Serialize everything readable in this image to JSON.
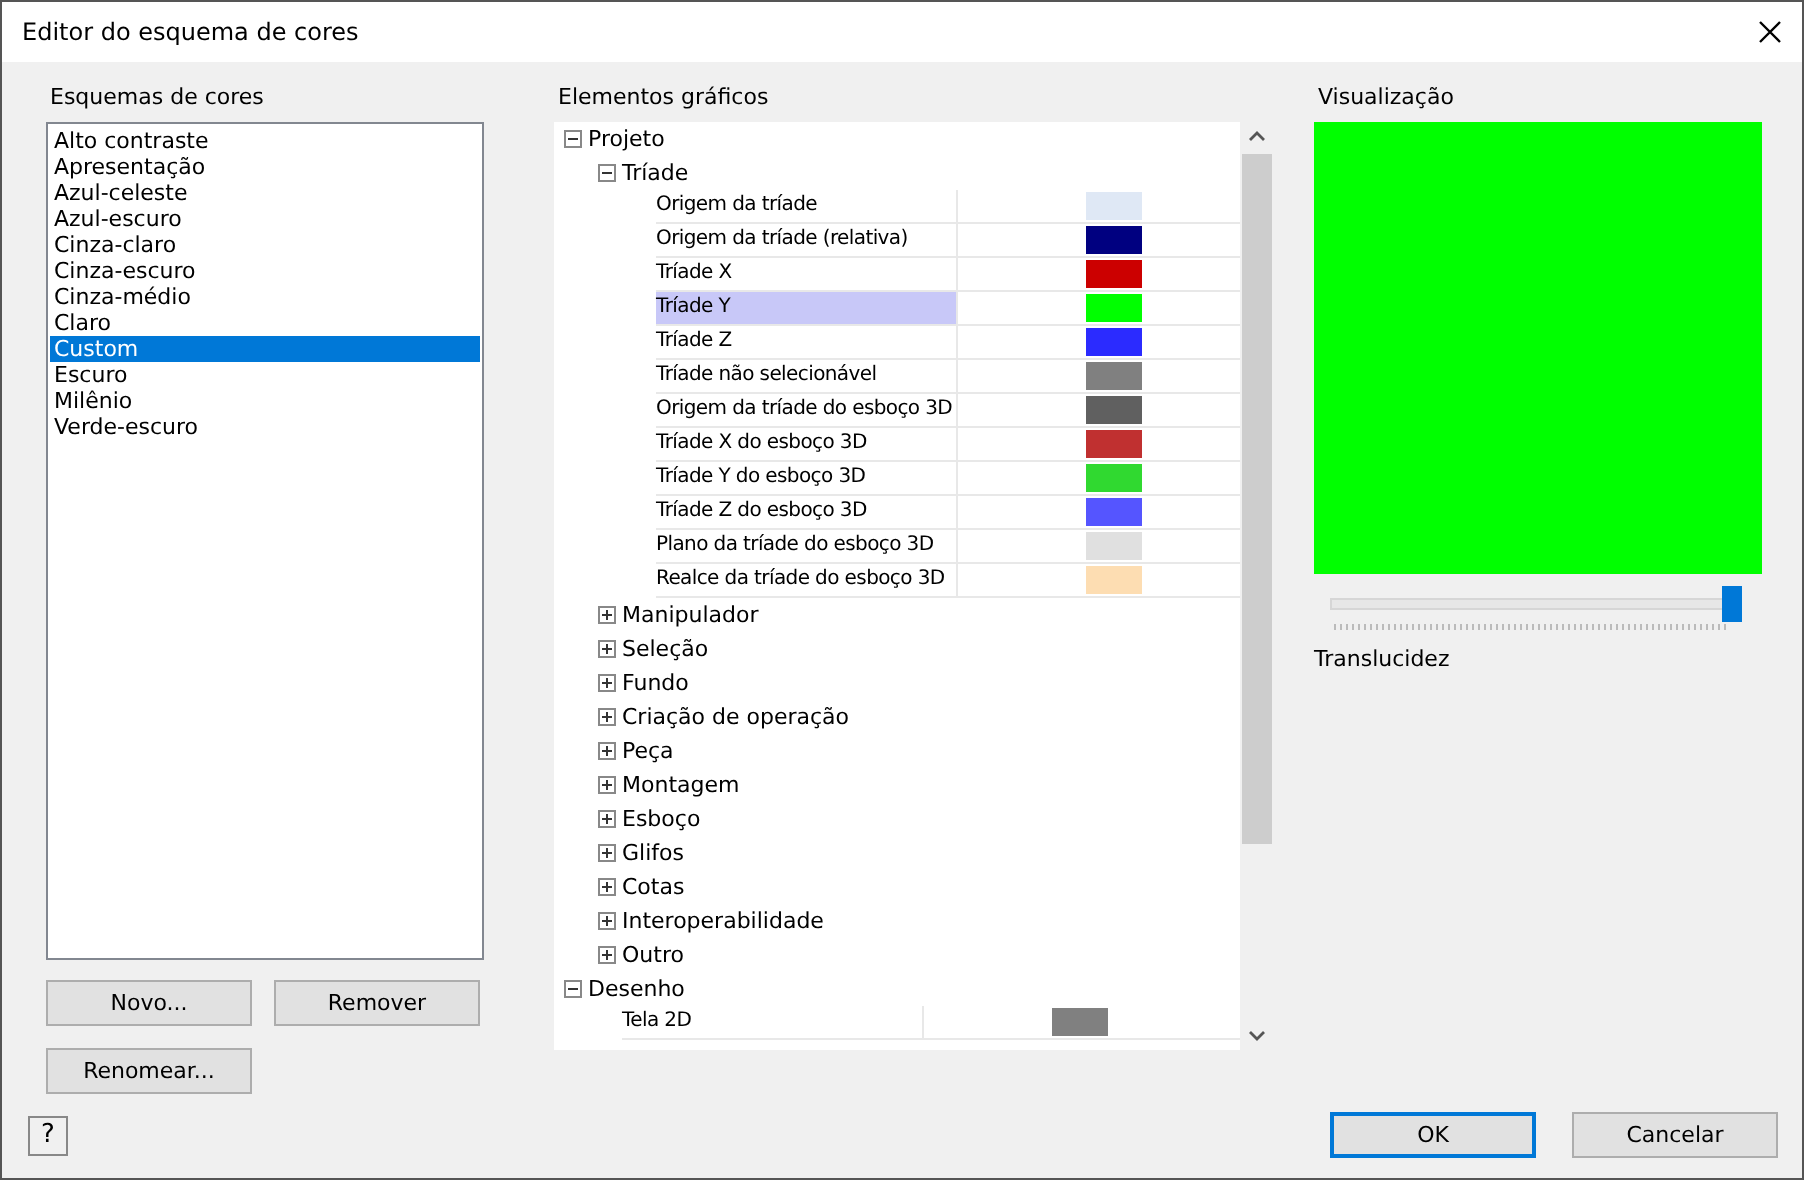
{
  "window": {
    "title": "Editor do esquema de cores"
  },
  "schemes": {
    "label": "Esquemas de cores",
    "items": [
      {
        "label": "Alto contraste",
        "selected": false
      },
      {
        "label": "Apresentação",
        "selected": false
      },
      {
        "label": "Azul-celeste",
        "selected": false
      },
      {
        "label": "Azul-escuro",
        "selected": false
      },
      {
        "label": "Cinza-claro",
        "selected": false
      },
      {
        "label": "Cinza-escuro",
        "selected": false
      },
      {
        "label": "Cinza-médio",
        "selected": false
      },
      {
        "label": "Claro",
        "selected": false
      },
      {
        "label": "Custom",
        "selected": true
      },
      {
        "label": "Escuro",
        "selected": false
      },
      {
        "label": "Milênio",
        "selected": false
      },
      {
        "label": "Verde-escuro",
        "selected": false
      }
    ],
    "buttons": [
      "Novo...",
      "Remover",
      "Renomear..."
    ]
  },
  "elements": {
    "label": "Elementos gráficos",
    "tree": [
      {
        "kind": "group",
        "label": "Projeto",
        "expanded": true,
        "children": [
          {
            "kind": "group",
            "label": "Tríade",
            "expanded": true,
            "children": [
              {
                "kind": "color",
                "label": "Origem da tríade",
                "color": "#dfe8f5",
                "selected": false
              },
              {
                "kind": "color",
                "label": "Origem da tríade (relativa)",
                "color": "#000080",
                "selected": false
              },
              {
                "kind": "color",
                "label": "Tríade X",
                "color": "#cc0000",
                "selected": false
              },
              {
                "kind": "color",
                "label": "Tríade Y",
                "color": "#00ff00",
                "selected": true
              },
              {
                "kind": "color",
                "label": "Tríade Z",
                "color": "#2b2bff",
                "selected": false
              },
              {
                "kind": "color",
                "label": "Tríade não selecionável",
                "color": "#808080",
                "selected": false
              },
              {
                "kind": "color",
                "label": "Origem da tríade do esboço 3D",
                "color": "#606060",
                "selected": false
              },
              {
                "kind": "color",
                "label": "Tríade X do esboço 3D",
                "color": "#c03030",
                "selected": false
              },
              {
                "kind": "color",
                "label": "Tríade Y do esboço 3D",
                "color": "#30d930",
                "selected": false
              },
              {
                "kind": "color",
                "label": "Tríade Z do esboço 3D",
                "color": "#5555ff",
                "selected": false
              },
              {
                "kind": "color",
                "label": "Plano da tríade do esboço 3D",
                "color": "#e0e0e0",
                "selected": false
              },
              {
                "kind": "color",
                "label": "Realce da tríade do esboço 3D",
                "color": "#fdddb2",
                "selected": false
              }
            ]
          },
          {
            "kind": "group",
            "label": "Manipulador",
            "expanded": false
          },
          {
            "kind": "group",
            "label": "Seleção",
            "expanded": false
          },
          {
            "kind": "group",
            "label": "Fundo",
            "expanded": false
          },
          {
            "kind": "group",
            "label": "Criação de operação",
            "expanded": false
          },
          {
            "kind": "group",
            "label": "Peça",
            "expanded": false
          },
          {
            "kind": "group",
            "label": "Montagem",
            "expanded": false
          },
          {
            "kind": "group",
            "label": "Esboço",
            "expanded": false
          },
          {
            "kind": "group",
            "label": "Glifos",
            "expanded": false
          },
          {
            "kind": "group",
            "label": "Cotas",
            "expanded": false
          },
          {
            "kind": "group",
            "label": "Interoperabilidade",
            "expanded": false
          },
          {
            "kind": "group",
            "label": "Outro",
            "expanded": false
          }
        ]
      },
      {
        "kind": "group",
        "label": "Desenho",
        "expanded": true,
        "children": [
          {
            "kind": "color",
            "label": "Tela 2D",
            "color": "#808080",
            "selected": false
          }
        ]
      }
    ]
  },
  "preview": {
    "label": "Visualização",
    "color": "#00ff00",
    "translucency_label": "Translucidez",
    "level": 1.0
  },
  "help": "?",
  "buttons": [
    "OK",
    "Cancelar"
  ]
}
